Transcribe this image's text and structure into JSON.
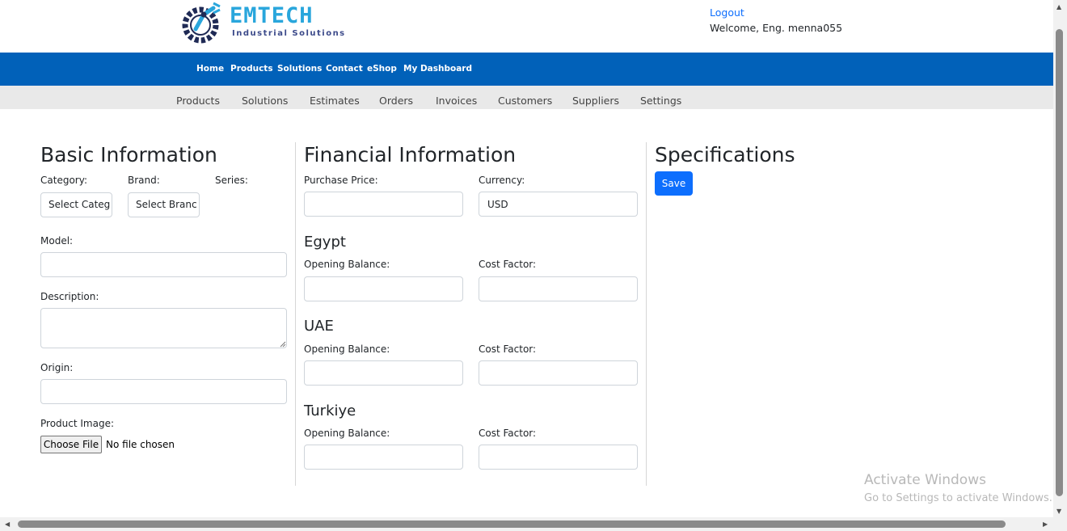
{
  "header": {
    "logo_text": "EMTECH",
    "logo_subtitle": "Industrial Solutions",
    "logout_label": "Logout",
    "welcome_text": "Welcome, Eng. menna055"
  },
  "main_nav": [
    "Home",
    "Products",
    "Solutions",
    "Contact",
    "eShop",
    "My Dashboard"
  ],
  "sub_nav": [
    "Products",
    "Solutions",
    "Estimates",
    "Orders",
    "Invoices",
    "Customers",
    "Suppliers",
    "Settings"
  ],
  "basic": {
    "title": "Basic Information",
    "category_label": "Category:",
    "category_value": "Select Categ",
    "brand_label": "Brand:",
    "brand_value": "Select Branc",
    "series_label": "Series:",
    "model_label": "Model:",
    "description_label": "Description:",
    "origin_label": "Origin:",
    "image_label": "Product Image:",
    "choose_file_label": "Choose File",
    "no_file_text": "No file chosen"
  },
  "financial": {
    "title": "Financial Information",
    "purchase_price_label": "Purchase Price:",
    "currency_label": "Currency:",
    "currency_value": "USD",
    "regions": [
      {
        "name": "Egypt",
        "opening_label": "Opening Balance:",
        "cost_label": "Cost Factor:"
      },
      {
        "name": "UAE",
        "opening_label": "Opening Balance:",
        "cost_label": "Cost Factor:"
      },
      {
        "name": "Turkiye",
        "opening_label": "Opening Balance:",
        "cost_label": "Cost Factor:"
      }
    ]
  },
  "specs": {
    "title": "Specifications",
    "save_label": "Save"
  },
  "watermark": {
    "line1": "Activate Windows",
    "line2": "Go to Settings to activate Windows."
  },
  "colors": {
    "nav_blue": "#0161b9",
    "primary": "#0d6efd",
    "subnav_grey": "#e9e9e9"
  }
}
